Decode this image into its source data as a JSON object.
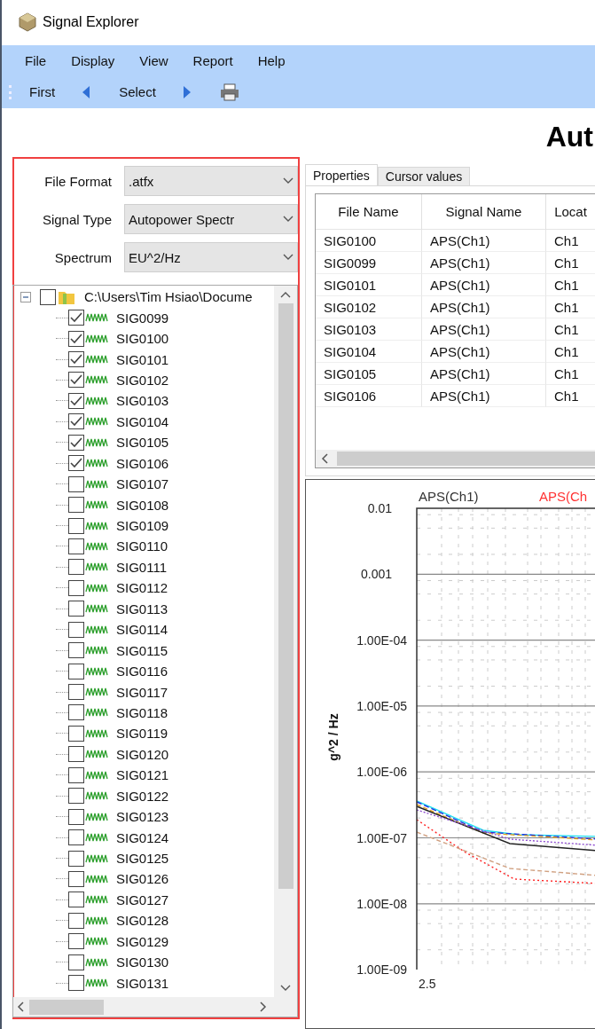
{
  "window": {
    "title": "Signal Explorer"
  },
  "menu": [
    "File",
    "Display",
    "View",
    "Report",
    "Help"
  ],
  "toolbar": [
    {
      "kind": "text",
      "label": "First"
    },
    {
      "kind": "prev"
    },
    {
      "kind": "text",
      "label": "Select"
    },
    {
      "kind": "next"
    },
    {
      "kind": "print"
    }
  ],
  "page_title": "Aut",
  "filters": [
    {
      "label": "File Format",
      "value": ".atfx"
    },
    {
      "label": "Signal Type",
      "value": "Autopower Spectr"
    },
    {
      "label": "Spectrum",
      "value": "EU^2/Hz"
    }
  ],
  "tree": {
    "label": "C:\\Users\\Tim Hsiao\\Docume",
    "checked": false,
    "expanded": true,
    "children": [
      {
        "label": "SIG0099",
        "checked": true
      },
      {
        "label": "SIG0100",
        "checked": true
      },
      {
        "label": "SIG0101",
        "checked": true
      },
      {
        "label": "SIG0102",
        "checked": true
      },
      {
        "label": "SIG0103",
        "checked": true
      },
      {
        "label": "SIG0104",
        "checked": true
      },
      {
        "label": "SIG0105",
        "checked": true
      },
      {
        "label": "SIG0106",
        "checked": true
      },
      {
        "label": "SIG0107",
        "checked": false
      },
      {
        "label": "SIG0108",
        "checked": false
      },
      {
        "label": "SIG0109",
        "checked": false
      },
      {
        "label": "SIG0110",
        "checked": false
      },
      {
        "label": "SIG0111",
        "checked": false
      },
      {
        "label": "SIG0112",
        "checked": false
      },
      {
        "label": "SIG0113",
        "checked": false
      },
      {
        "label": "SIG0114",
        "checked": false
      },
      {
        "label": "SIG0115",
        "checked": false
      },
      {
        "label": "SIG0116",
        "checked": false
      },
      {
        "label": "SIG0117",
        "checked": false
      },
      {
        "label": "SIG0118",
        "checked": false
      },
      {
        "label": "SIG0119",
        "checked": false
      },
      {
        "label": "SIG0120",
        "checked": false
      },
      {
        "label": "SIG0121",
        "checked": false
      },
      {
        "label": "SIG0122",
        "checked": false
      },
      {
        "label": "SIG0123",
        "checked": false
      },
      {
        "label": "SIG0124",
        "checked": false
      },
      {
        "label": "SIG0125",
        "checked": false
      },
      {
        "label": "SIG0126",
        "checked": false
      },
      {
        "label": "SIG0127",
        "checked": false
      },
      {
        "label": "SIG0128",
        "checked": false
      },
      {
        "label": "SIG0129",
        "checked": false
      },
      {
        "label": "SIG0130",
        "checked": false
      },
      {
        "label": "SIG0131",
        "checked": false
      }
    ]
  },
  "tabs": [
    {
      "label": "Properties",
      "selected": true
    },
    {
      "label": "Cursor values",
      "selected": false
    }
  ],
  "table": {
    "columns": [
      "File Name",
      "Signal Name",
      "Locat"
    ],
    "rows": [
      [
        "SIG0100",
        "APS(Ch1)",
        "Ch1"
      ],
      [
        "SIG0099",
        "APS(Ch1)",
        "Ch1"
      ],
      [
        "SIG0101",
        "APS(Ch1)",
        "Ch1"
      ],
      [
        "SIG0102",
        "APS(Ch1)",
        "Ch1"
      ],
      [
        "SIG0103",
        "APS(Ch1)",
        "Ch1"
      ],
      [
        "SIG0104",
        "APS(Ch1)",
        "Ch1"
      ],
      [
        "SIG0105",
        "APS(Ch1)",
        "Ch1"
      ],
      [
        "SIG0106",
        "APS(Ch1)",
        "Ch1"
      ]
    ]
  },
  "chart": {
    "legend": [
      {
        "label": "APS(Ch1)",
        "color": "#333333"
      },
      {
        "label": "APS(Ch",
        "color": "#ff3333"
      }
    ],
    "ylabel": "g^2 / Hz",
    "yticks": [
      "0.01",
      "0.001",
      "1.00E-04",
      "1.00E-05",
      "1.00E-06",
      "1.00E-07",
      "1.00E-08",
      "1.00E-09"
    ],
    "xticks": [
      "2.5"
    ]
  }
}
